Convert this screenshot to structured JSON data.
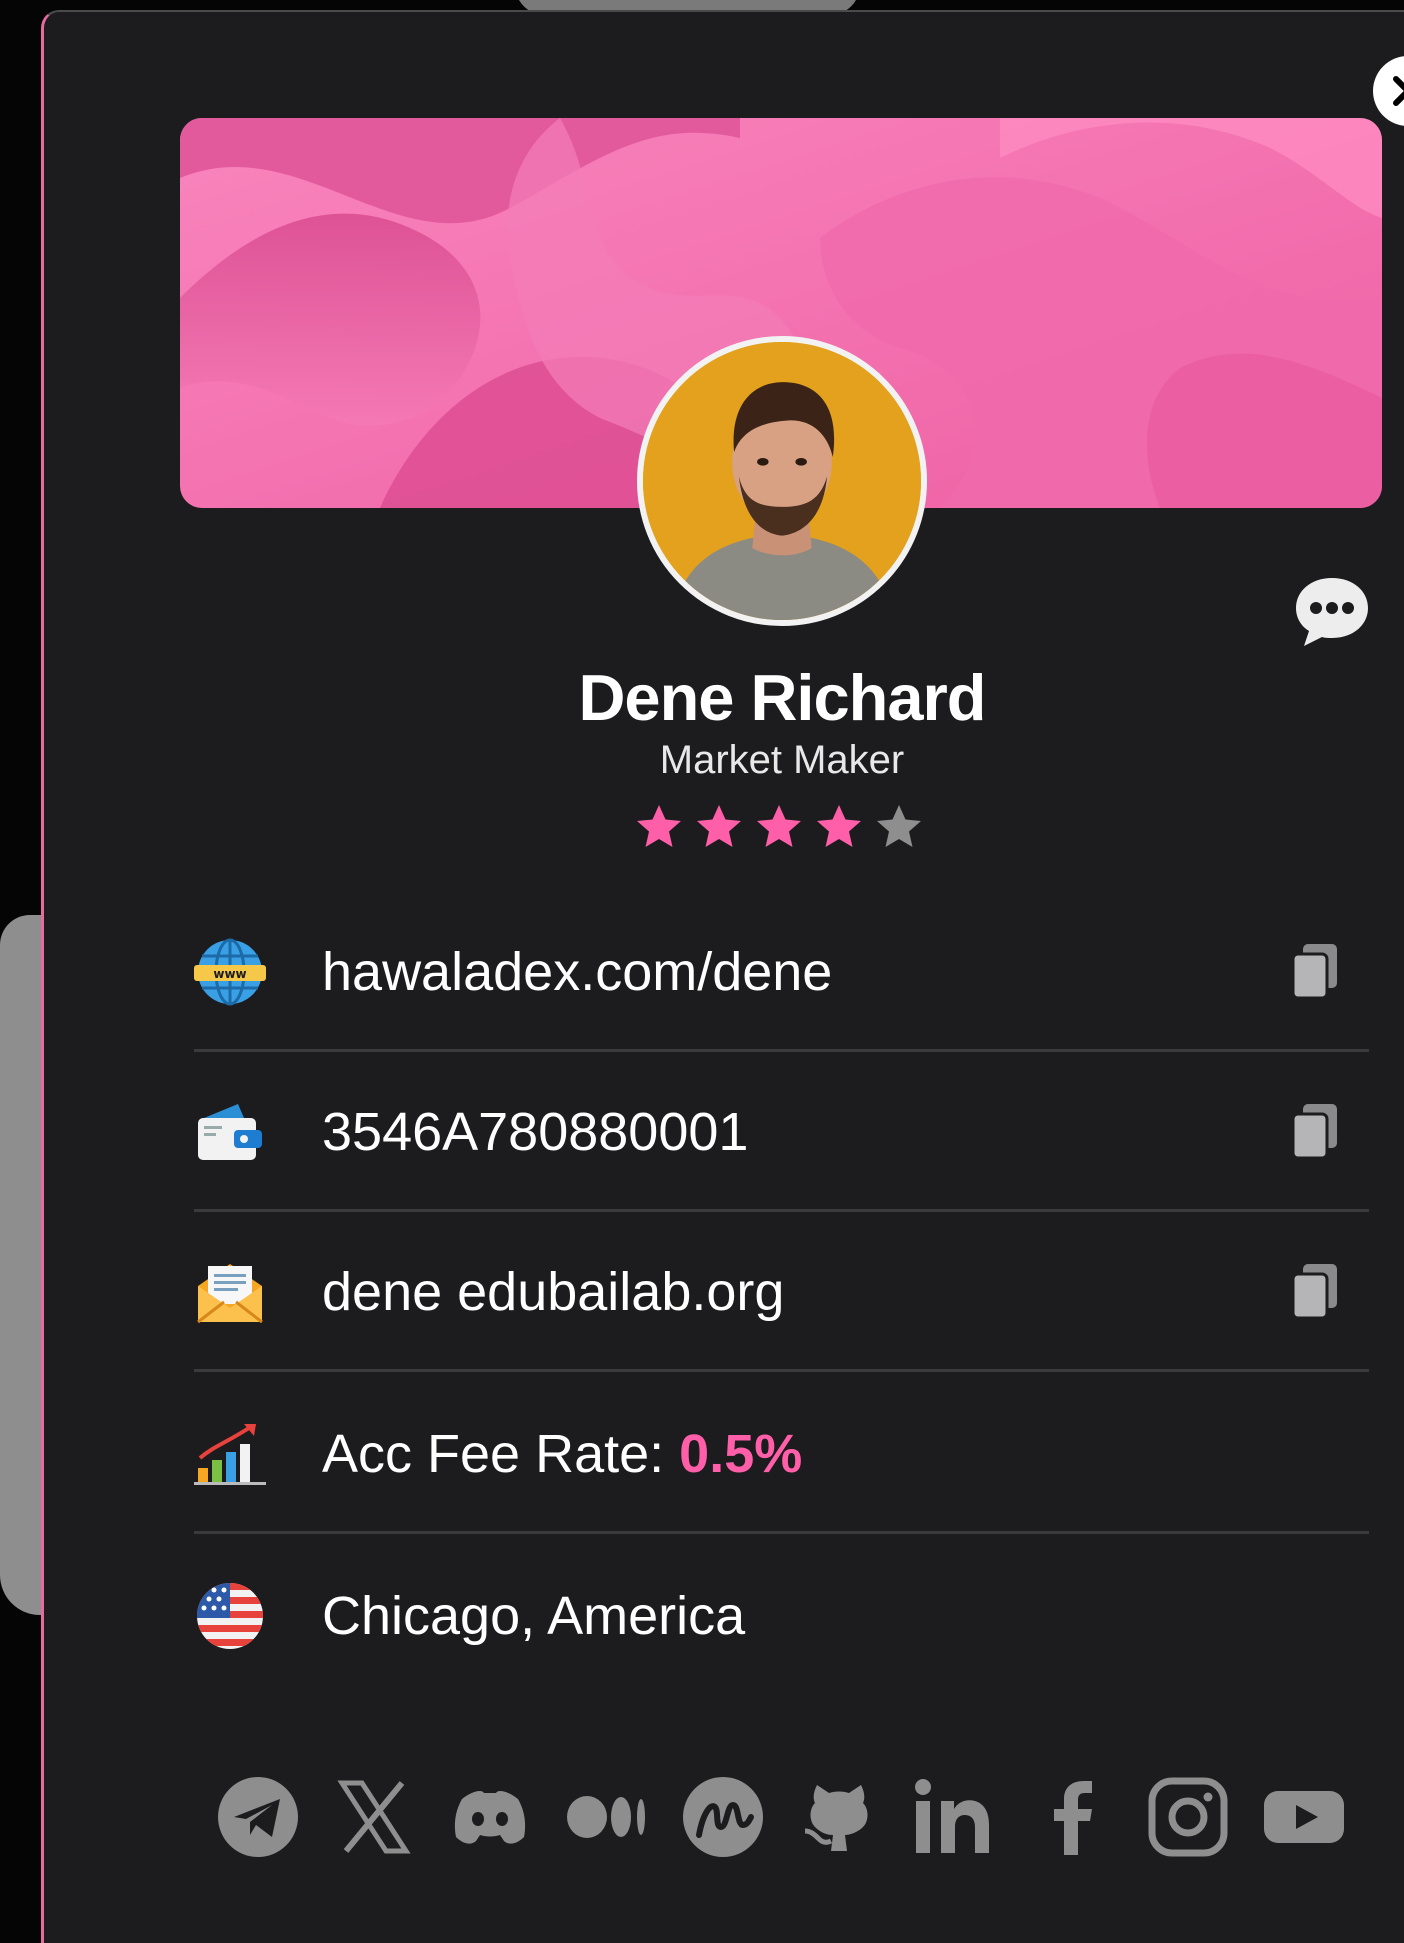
{
  "profile": {
    "name": "Dene Richard",
    "role": "Market Maker",
    "rating": 4,
    "rating_max": 5
  },
  "info": {
    "website": "hawaladex.com/dene",
    "wallet": "3546A780880001",
    "email": "dene edubailab.org",
    "fee_label": "Acc Fee Rate: ",
    "fee_value": "0.5%",
    "location": "Chicago, America"
  },
  "icons": {
    "close": "close-icon",
    "chat": "chat-bubble-icon",
    "website": "globe-www-icon",
    "wallet": "wallet-icon",
    "email": "envelope-icon",
    "fee": "growth-chart-icon",
    "location": "us-flag-icon",
    "copy": "copy-icon",
    "socials": [
      "telegram-icon",
      "x-icon",
      "discord-icon",
      "medium-icon",
      "coinmarketcap-icon",
      "github-icon",
      "linkedin-icon",
      "facebook-icon",
      "instagram-icon",
      "youtube-icon"
    ]
  },
  "colors": {
    "accent": "#ff5ea8",
    "background": "#1c1c1e",
    "banner": "#f472ad",
    "social_icons": "#8e8e8e"
  }
}
